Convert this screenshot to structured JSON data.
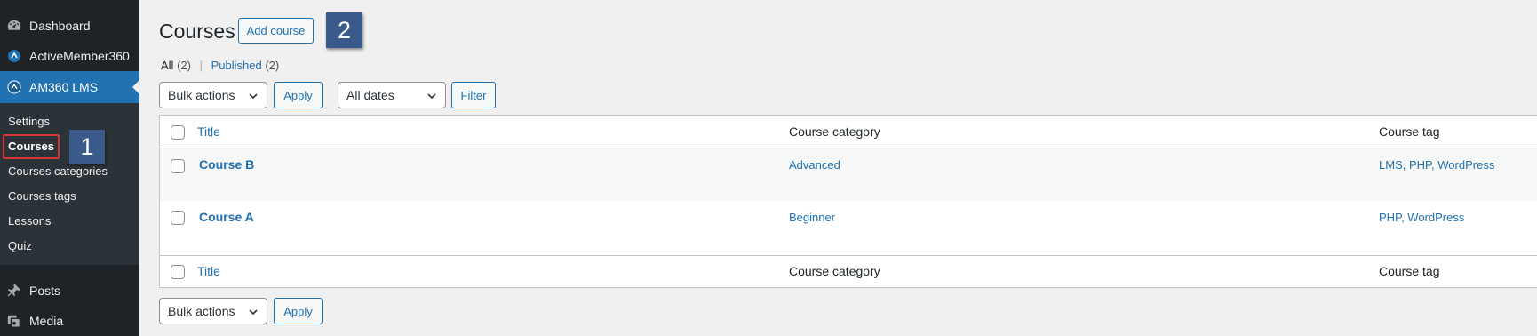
{
  "sidebar": {
    "menu": [
      {
        "label": "Dashboard",
        "icon": "dashboard-icon"
      },
      {
        "label": "ActiveMember360",
        "icon": "activemember-icon"
      },
      {
        "label": "AM360 LMS",
        "icon": "am360-lms-icon"
      }
    ],
    "submenu": [
      "Settings",
      "Courses",
      "Courses categories",
      "Courses tags",
      "Lessons",
      "Quiz"
    ],
    "bottom_menu": [
      {
        "label": "Posts",
        "icon": "pin-icon"
      },
      {
        "label": "Media",
        "icon": "media-icon"
      }
    ]
  },
  "annotations": {
    "one": "1",
    "two": "2"
  },
  "page": {
    "title": "Courses",
    "add_button": "Add course",
    "views": {
      "all_label": "All",
      "all_count": "(2)",
      "sep": "|",
      "published_label": "Published",
      "published_count": "(2)"
    }
  },
  "filters": {
    "bulk_actions": "Bulk actions",
    "apply": "Apply",
    "all_dates": "All dates",
    "filter": "Filter"
  },
  "table": {
    "columns": {
      "title": "Title",
      "category": "Course category",
      "tag": "Course tag"
    },
    "rows": [
      {
        "title": "Course B",
        "category": "Advanced",
        "tags": [
          "LMS",
          "PHP",
          "WordPress"
        ]
      },
      {
        "title": "Course A",
        "category": "Beginner",
        "tags": [
          "PHP",
          "WordPress"
        ]
      }
    ]
  },
  "colors": {
    "sidebar_bg": "#1d2327",
    "submenu_bg": "#2c3338",
    "accent": "#2271b1",
    "callout_bg": "#3a5a8c",
    "highlight_border": "#d63638"
  }
}
